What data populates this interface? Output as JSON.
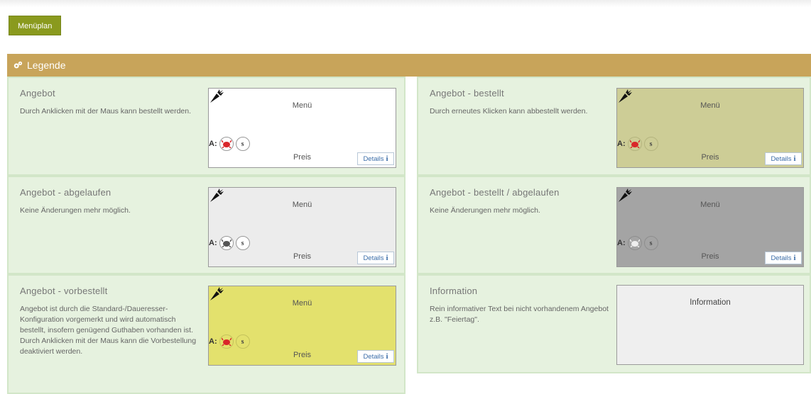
{
  "toolbar": {
    "menuplan_label": "Menüplan"
  },
  "legend": {
    "title": "Legende",
    "items": [
      {
        "title": "Angebot",
        "description": "Durch Anklicken mit der Maus kann bestellt werden.",
        "card": {
          "menu": "Menü",
          "price": "Preis",
          "a_label": "A:",
          "s_label": "s",
          "details": "Details",
          "bg": "#ffffff",
          "crab_color": "#d9262a"
        }
      },
      {
        "title": "Angebot - bestellt",
        "description": "Durch erneutes Klicken kann abbestellt werden.",
        "card": {
          "menu": "Menü",
          "price": "Preis",
          "a_label": "A:",
          "s_label": "s",
          "details": "Details",
          "bg": "#cdcd96",
          "crab_color": "#d9262a"
        }
      },
      {
        "title": "Angebot - abgelaufen",
        "description": "Keine Änderungen mehr möglich.",
        "card": {
          "menu": "Menü",
          "price": "Preis",
          "a_label": "A:",
          "s_label": "s",
          "details": "Details",
          "bg": "#ececec",
          "crab_color": "#555555"
        }
      },
      {
        "title": "Angebot - bestellt / abgelaufen",
        "description": "Keine Änderungen mehr möglich.",
        "card": {
          "menu": "Menü",
          "price": "Preis",
          "a_label": "A:",
          "s_label": "s",
          "details": "Details",
          "bg": "#a4a4a4",
          "crab_color": "#eeeeee"
        }
      },
      {
        "title": "Angebot - vorbestellt",
        "description": "Angebot ist durch die Standard-/Daueresser-Konfiguration vorgemerkt und wird automatisch bestellt, insofern genügend Guthaben vorhanden ist. Durch Anklicken mit der Maus kann die Vorbestellung deaktiviert werden.",
        "card": {
          "menu": "Menü",
          "price": "Preis",
          "a_label": "A:",
          "s_label": "s",
          "details": "Details",
          "bg": "#e3e16d",
          "crab_color": "#d9262a"
        }
      },
      {
        "title": "Information",
        "description": "Rein informativer Text bei nicht vorhandenem Angebot z.B. \"Feiertag\".",
        "info_card": {
          "text": "Information"
        }
      }
    ]
  }
}
